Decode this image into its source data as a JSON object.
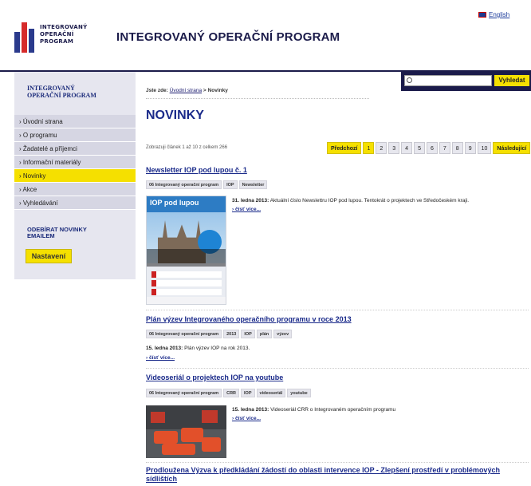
{
  "header": {
    "logo_lines": [
      "INTEGROVANÝ",
      "OPERAČNÍ",
      "PROGRAM"
    ],
    "site_title": "INTEGROVANÝ OPERAČNÍ PROGRAM",
    "lang_link": "English"
  },
  "sidebar": {
    "heading_lines": [
      "INTEGROVANÝ",
      "OPERAČNÍ PROGRAM"
    ],
    "items": [
      {
        "label": "› Úvodní strana",
        "active": false
      },
      {
        "label": "› O programu",
        "active": false
      },
      {
        "label": "› Žadatelé a příjemci",
        "active": false
      },
      {
        "label": "› Informační materiály",
        "active": false
      },
      {
        "label": "› Novinky",
        "active": true
      },
      {
        "label": "› Akce",
        "active": false
      },
      {
        "label": "› Vyhledávání",
        "active": false
      }
    ],
    "subscribe_lines": [
      "ODEBÍRAT NOVINKY",
      "EMAILEM"
    ],
    "settings_button": "Nastavení"
  },
  "search": {
    "placeholder": "",
    "button": "Vyhledat"
  },
  "breadcrumb": {
    "prefix": "Jste zde:",
    "home": "Úvodní strana",
    "separator": " > ",
    "current": "Novinky"
  },
  "page_title": "NOVINKY",
  "listing": {
    "summary": "Zobrazuji článek 1 až 10 z celkem 266",
    "pager": {
      "prev": "Předchozí",
      "pages": [
        "1",
        "2",
        "3",
        "4",
        "5",
        "6",
        "7",
        "8",
        "9",
        "10"
      ],
      "current": "1",
      "next": "Následující"
    }
  },
  "articles": [
    {
      "title": "Newsletter IOP pod lupou č. 1",
      "tags": [
        "06 Integrovaný operační program",
        "IOP",
        "Newsletter"
      ],
      "date": "31. ledna 2013:",
      "text": "Aktuální číslo Newslettru IOP pod lupou. Tentokrát o projektech ve Středočeském kraji.",
      "more": "› čísť více...",
      "thumb_title": "IOP pod lupou"
    },
    {
      "title": "Plán výzev Integrovaného operačního programu v roce 2013",
      "tags": [
        "06 Integrovaný operační program",
        "2013",
        "IOP",
        "plán",
        "výzev"
      ],
      "date": "15. ledna 2013:",
      "text": "Plán výzev IOP na rok 2013.",
      "more": "› čísť více..."
    },
    {
      "title": "Videoseriál o projektech IOP na youtube",
      "tags": [
        "06 Integrovaný operační program",
        "CRR",
        "IOP",
        "videoseriál",
        "youtube"
      ],
      "date": "15. ledna 2013:",
      "text": "Videoseriál CRR o Integrovaném operačním programu",
      "more": "› čísť více..."
    },
    {
      "title": "Prodloužena Výzva k předkládání žádostí do oblasti intervence IOP - Zlepšení prostředí v problémových sídlištích"
    }
  ],
  "colors": {
    "brand_navy": "#1b1b4a",
    "link_blue": "#1a2a8a",
    "accent_yellow": "#f5e000",
    "sidebar_bg": "#e6e6ef"
  },
  "icons": [
    "search-icon",
    "uk-flag-icon"
  ]
}
